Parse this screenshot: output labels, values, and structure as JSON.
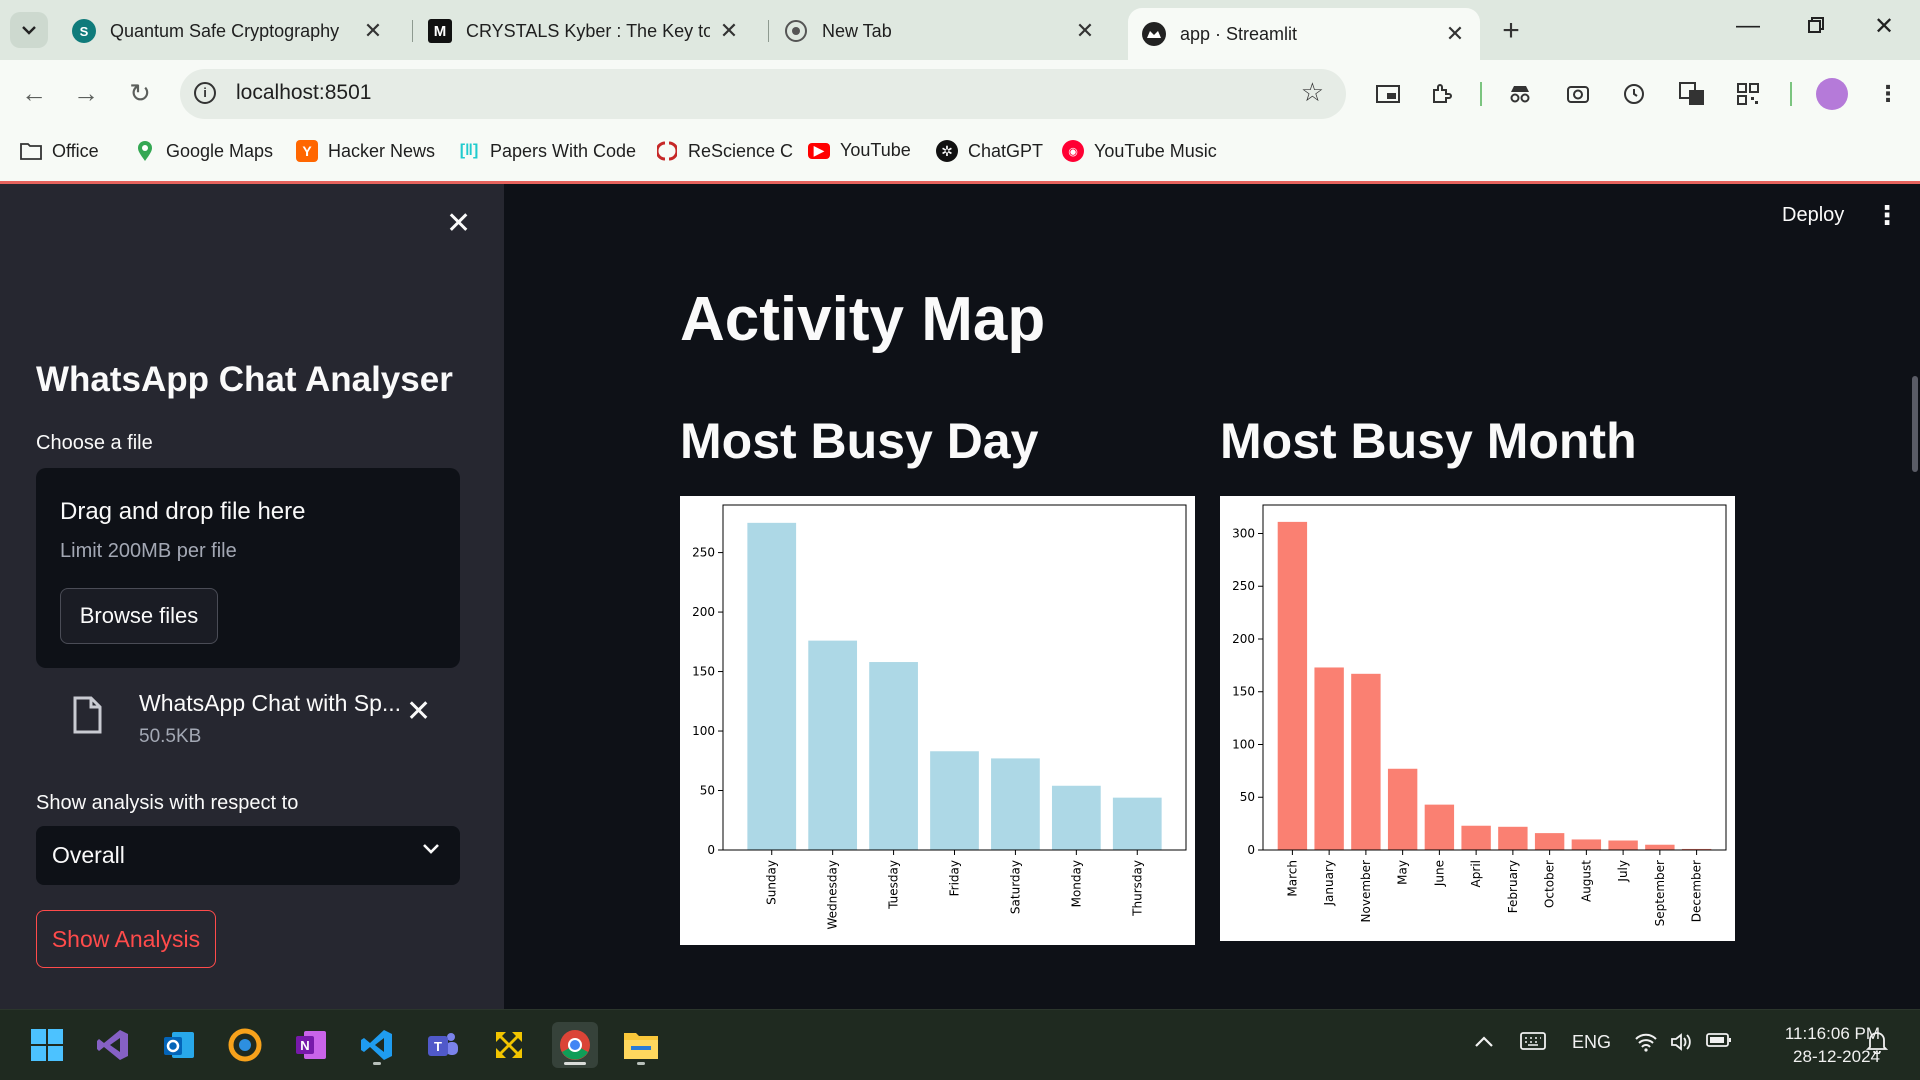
{
  "browser": {
    "tabs": [
      {
        "title": "Quantum Safe Cryptography",
        "favicon": "sharepoint-icon"
      },
      {
        "title": "CRYSTALS Kyber : The Key to Po",
        "favicon": "medium-icon"
      },
      {
        "title": "New Tab",
        "favicon": "chrome-icon"
      },
      {
        "title": "app · Streamlit",
        "favicon": "streamlit-icon"
      }
    ],
    "url": "localhost:8501",
    "bookmarks": [
      "Office",
      "Google Maps",
      "Hacker News",
      "Papers With Code",
      "ReScience C",
      "YouTube",
      "ChatGPT",
      "YouTube Music"
    ]
  },
  "sidebar": {
    "title": "WhatsApp Chat Analyser",
    "file_label": "Choose a file",
    "dropzone_heading": "Drag and drop file here",
    "dropzone_limit": "Limit 200MB per file",
    "browse_label": "Browse files",
    "uploaded_file_name": "WhatsApp Chat with Sp...",
    "uploaded_file_size": "50.5KB",
    "analysis_label": "Show analysis with respect to",
    "selected_option": "Overall",
    "show_button": "Show Analysis"
  },
  "main": {
    "deploy_label": "Deploy",
    "page_title": "Activity Map",
    "busy_day_title": "Most Busy Day",
    "busy_month_title": "Most Busy Month"
  },
  "chart_data": [
    {
      "type": "bar",
      "categories": [
        "Sunday",
        "Wednesday",
        "Tuesday",
        "Friday",
        "Saturday",
        "Monday",
        "Thursday"
      ],
      "values": [
        275,
        176,
        158,
        83,
        77,
        54,
        44
      ],
      "ylim": [
        0,
        290
      ],
      "yticks": [
        0,
        50,
        100,
        150,
        200,
        250
      ],
      "color": "#add8e6",
      "title": "",
      "xlabel": "",
      "ylabel": ""
    },
    {
      "type": "bar",
      "categories": [
        "March",
        "January",
        "November",
        "May",
        "June",
        "April",
        "February",
        "October",
        "August",
        "July",
        "September",
        "December"
      ],
      "values": [
        311,
        173,
        167,
        77,
        43,
        23,
        22,
        16,
        10,
        9,
        5,
        1
      ],
      "ylim": [
        0,
        327
      ],
      "yticks": [
        0,
        50,
        100,
        150,
        200,
        250,
        300
      ],
      "color": "#fa8072",
      "title": "",
      "xlabel": "",
      "ylabel": ""
    }
  ],
  "taskbar": {
    "apps": [
      "windows-start-icon",
      "visual-studio-icon",
      "outlook-icon",
      "swift-icon",
      "onenote-icon",
      "vscode-icon",
      "teams-icon",
      "vpn-icon",
      "chrome-icon",
      "file-explorer-icon"
    ],
    "language": "ENG",
    "time": "11:16:06 PM",
    "date": "28-12-2024"
  },
  "colors": {
    "accent": "#ff4b4b",
    "app_bg": "#0e1117",
    "sidebar_bg": "#262730"
  }
}
